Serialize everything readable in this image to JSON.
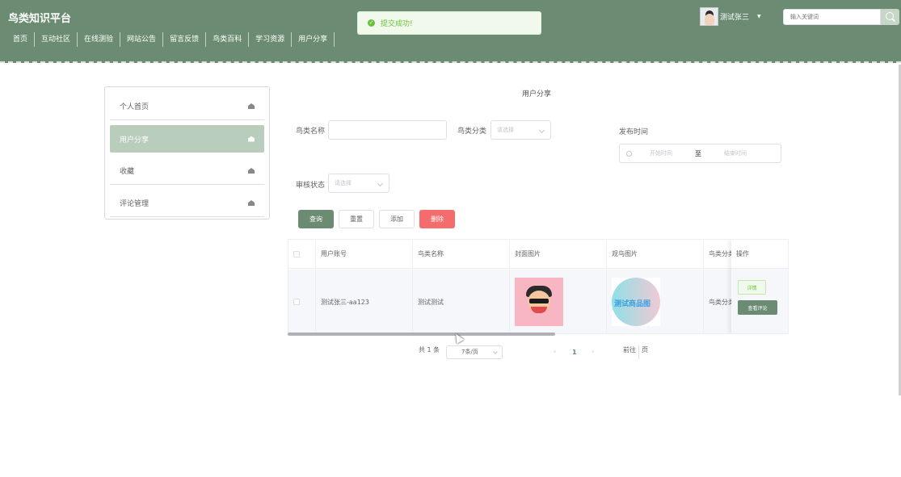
{
  "header": {
    "brand": "鸟类知识平台",
    "nav": [
      "首页",
      "互动社区",
      "在线测验",
      "网站公告",
      "留言反馈",
      "鸟类百科",
      "学习资源",
      "用户分享"
    ],
    "toast": "提交成功!",
    "user_name": "测试张三",
    "search_placeholder": "输入关键词"
  },
  "sidebar": {
    "items": [
      {
        "label": "个人首页",
        "active": false
      },
      {
        "label": "用户分享",
        "active": true
      },
      {
        "label": "收藏",
        "active": false
      },
      {
        "label": "评论管理",
        "active": false
      }
    ]
  },
  "main": {
    "title": "用户分享",
    "filters": {
      "bird_name_label": "鸟类名称",
      "bird_category_label": "鸟类分类",
      "bird_category_placeholder": "请选择",
      "publish_time_label": "发布时间",
      "start_placeholder": "开始时间",
      "range_sep": "至",
      "end_placeholder": "结束时间",
      "review_status_label": "审核状态",
      "review_status_placeholder": "请选择"
    },
    "buttons": {
      "query": "查询",
      "reset": "重置",
      "add": "添加",
      "delete": "删除"
    },
    "table": {
      "columns": [
        "用户账号",
        "鸟类名称",
        "封面图片",
        "观鸟图片",
        "鸟类分类",
        "操作"
      ],
      "rows": [
        {
          "account": "测试张三-aa123",
          "bird_name": "测试测试",
          "watch_image_text": "测试商品图",
          "category": "鸟类分类"
        }
      ],
      "actions": {
        "detail": "详情",
        "view_comments": "查看评论"
      }
    },
    "pagination": {
      "total": "共 1 条",
      "page_size": "7条/页",
      "current_page": "1",
      "goto_label": "前往",
      "goto_suffix": "页"
    }
  },
  "colors": {
    "primary": "#6b8b72",
    "sidebar_active": "#b9cdbd",
    "danger": "#f56c6c",
    "success": "#67c23a"
  }
}
